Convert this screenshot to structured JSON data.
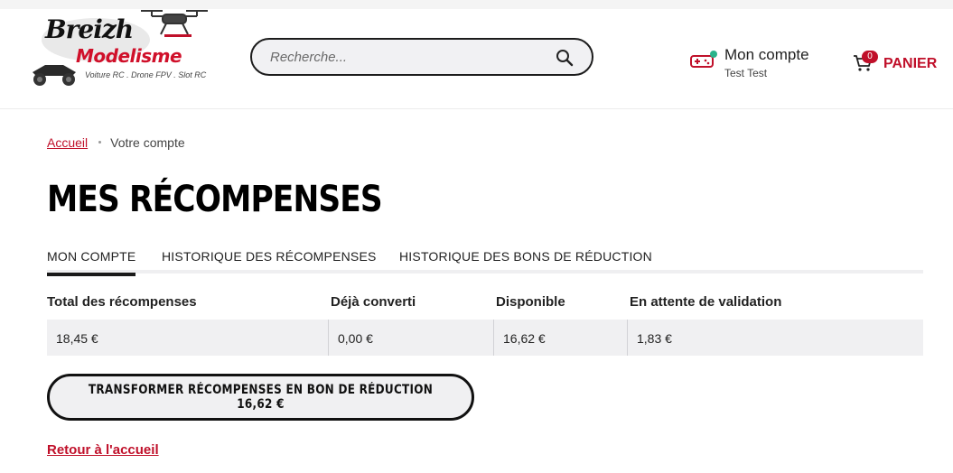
{
  "header": {
    "logo": {
      "line1": "Breizh",
      "line2": "Modelisme",
      "tagline": "Voiture RC . Drone FPV . Slot RC"
    },
    "search": {
      "placeholder": "Recherche..."
    },
    "account": {
      "label": "Mon compte",
      "user": "Test Test"
    },
    "cart": {
      "count": "0",
      "label": "PANIER"
    }
  },
  "breadcrumb": {
    "home": "Accueil",
    "current": "Votre compte"
  },
  "page": {
    "title": "MES RÉCOMPENSES"
  },
  "tabs": [
    {
      "label": "MON COMPTE",
      "active": true
    },
    {
      "label": "HISTORIQUE DES RÉCOMPENSES",
      "active": false
    },
    {
      "label": "HISTORIQUE DES BONS DE RÉDUCTION",
      "active": false
    }
  ],
  "table": {
    "headers": [
      "Total des récompenses",
      "Déjà converti",
      "Disponible",
      "En attente de validation"
    ],
    "values": [
      "18,45 €",
      "0,00 €",
      "16,62 €",
      "1,83 €"
    ]
  },
  "actions": {
    "convert_label": "TRANSFORMER RÉCOMPENSES EN BON DE RÉDUCTION 16,62 €",
    "back_label": "Retour à l'accueil"
  },
  "colors": {
    "accent": "#c0102a",
    "status_online": "#29b38a",
    "row_bg": "#f0f0f2"
  }
}
